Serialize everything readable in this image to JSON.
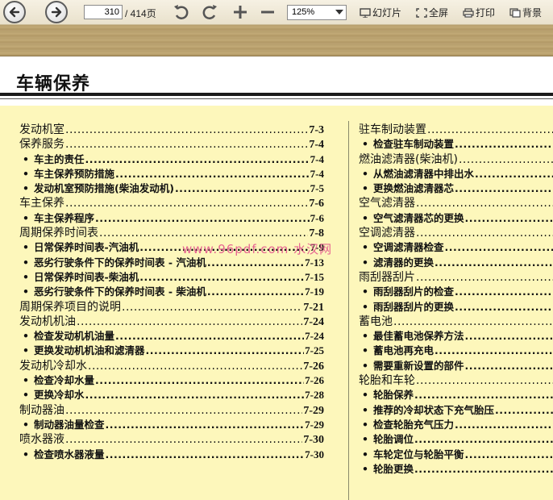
{
  "toolbar": {
    "page_current": "310",
    "page_total": "/ 414页",
    "zoom": "125%",
    "slideshow_label": "幻灯片",
    "fullscreen_label": "全屏",
    "print_label": "打印",
    "background_label": "背景"
  },
  "document": {
    "title": "车辆保养",
    "watermark": "www.96pdf.com 水汉网"
  },
  "toc_left": [
    {
      "type": "main",
      "text": "发动机室",
      "page": "7-3"
    },
    {
      "type": "main",
      "text": "保养服务",
      "page": "7-4"
    },
    {
      "type": "sub",
      "text": "车主的责任",
      "page": "7-4"
    },
    {
      "type": "sub",
      "text": "车主保养预防措施",
      "page": "7-4"
    },
    {
      "type": "sub",
      "text": "发动机室预防措施(柴油发动机)",
      "page": "7-5"
    },
    {
      "type": "main",
      "text": "车主保养",
      "page": "7-6"
    },
    {
      "type": "sub",
      "text": "车主保养程序",
      "page": "7-6"
    },
    {
      "type": "main",
      "text": "周期保养时间表",
      "page": "7-8"
    },
    {
      "type": "sub",
      "text": "日常保养时间表-汽油机",
      "page": "7-9"
    },
    {
      "type": "sub",
      "text": "恶劣行驶条件下的保养时间表 - 汽油机",
      "page": "7-13"
    },
    {
      "type": "sub",
      "text": "日常保养时间表-柴油机",
      "page": "7-15"
    },
    {
      "type": "sub",
      "text": "恶劣行驶条件下的保养时间表 - 柴油机",
      "page": "7-19"
    },
    {
      "type": "main",
      "text": "周期保养项目的说明",
      "page": "7-21"
    },
    {
      "type": "main",
      "text": "发动机机油",
      "page": "7-24"
    },
    {
      "type": "sub",
      "text": "检查发动机机油量",
      "page": "7-24"
    },
    {
      "type": "sub",
      "text": "更换发动机机油和滤清器",
      "page": "7-25"
    },
    {
      "type": "main",
      "text": "发动机冷却水",
      "page": "7-26"
    },
    {
      "type": "sub",
      "text": "检查冷却水量",
      "page": "7-26"
    },
    {
      "type": "sub",
      "text": "更换冷却水",
      "page": "7-28"
    },
    {
      "type": "main",
      "text": "制动器油",
      "page": "7-29"
    },
    {
      "type": "sub",
      "text": "制动器油量检查",
      "page": "7-29"
    },
    {
      "type": "main",
      "text": "喷水器液",
      "page": "7-30"
    },
    {
      "type": "sub",
      "text": "检查喷水器液量",
      "page": "7-30"
    }
  ],
  "toc_right": [
    {
      "type": "main",
      "text": "驻车制动装置",
      "page": ""
    },
    {
      "type": "sub",
      "text": "检查驻车制动装置",
      "page": ""
    },
    {
      "type": "main",
      "text": "燃油滤清器(柴油机)",
      "page": ""
    },
    {
      "type": "sub",
      "text": "从燃油滤清器中排出水",
      "page": ""
    },
    {
      "type": "sub",
      "text": "更换燃油滤清器芯",
      "page": ""
    },
    {
      "type": "main",
      "text": "空气滤清器",
      "page": ""
    },
    {
      "type": "sub",
      "text": "空气滤清器芯的更换",
      "page": ""
    },
    {
      "type": "main",
      "text": "空调滤清器",
      "page": ""
    },
    {
      "type": "sub",
      "text": "空调滤清器检查",
      "page": ""
    },
    {
      "type": "sub",
      "text": "滤清器的更换",
      "page": ""
    },
    {
      "type": "main",
      "text": "雨刮器刮片",
      "page": ""
    },
    {
      "type": "sub",
      "text": "雨刮器刮片的检查",
      "page": ""
    },
    {
      "type": "sub",
      "text": "雨刮器刮片的更换",
      "page": ""
    },
    {
      "type": "main",
      "text": "蓄电池",
      "page": ""
    },
    {
      "type": "sub",
      "text": "最佳蓄电池保养方法",
      "page": ""
    },
    {
      "type": "sub",
      "text": "蓄电池再充电",
      "page": ""
    },
    {
      "type": "sub",
      "text": "需要重新设置的部件",
      "page": ""
    },
    {
      "type": "main",
      "text": "轮胎和车轮",
      "page": ""
    },
    {
      "type": "sub",
      "text": "轮胎保养",
      "page": ""
    },
    {
      "type": "sub",
      "text": "推荐的冷却状态下充气胎压",
      "page": ""
    },
    {
      "type": "sub",
      "text": "检查轮胎充气压力",
      "page": ""
    },
    {
      "type": "sub",
      "text": "轮胎调位",
      "page": ""
    },
    {
      "type": "sub",
      "text": "车轮定位与轮胎平衡",
      "page": ""
    },
    {
      "type": "sub",
      "text": "轮胎更换",
      "page": ""
    }
  ]
}
